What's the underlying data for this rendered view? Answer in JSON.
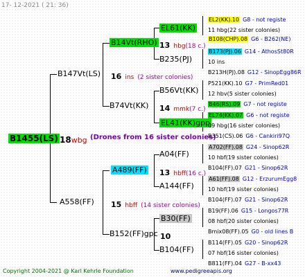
{
  "header": {
    "date": "17- 12-2021 ( 21: 36)"
  },
  "root": {
    "name": "B1455(LS)",
    "num": "18",
    "sub": "wbg",
    "note": "(Drones from 16 sister colonies)"
  },
  "l1": [
    {
      "name": "B147Vt(LS)",
      "num": "16",
      "sub": "ins",
      "note": "(2 sister colonies)"
    },
    {
      "name": "A558(FF)",
      "num": "15",
      "sub": "hbff",
      "note": "(14 sister colonies)"
    }
  ],
  "l2": [
    {
      "name": "B14Vt(RHO)",
      "num": "13",
      "sub": "hbg",
      "note": "(18 c.)"
    },
    {
      "name": "B74Vt(KK)",
      "num": "14",
      "sub": "mmk",
      "note": "(7 c.)"
    },
    {
      "name": "A489(FF)",
      "num": "13",
      "sub": "hbff",
      "note": "(16 c.)"
    },
    {
      "name": "B152(FF)gpc",
      "num": "10",
      "sub": "",
      "note": ""
    }
  ],
  "l3": [
    {
      "name": "EL61(KK)"
    },
    {
      "name": "B235(PJ)"
    },
    {
      "name": "B56Vt(KK)"
    },
    {
      "name": "EL41(KK)gpp"
    },
    {
      "name": "A04(FF)"
    },
    {
      "name": "A144(FF)"
    },
    {
      "name": "B30(FF)"
    },
    {
      "name": "B104(FF)"
    }
  ],
  "l4": [
    {
      "name": "EL2(KK).10",
      "info": "G8 - not registe"
    },
    {
      "name": "11 hbg(22 sister colonies)"
    },
    {
      "name": "B108(CHP).08",
      "info": "G6 - B262(NE)"
    },
    {
      "name": "B173(PJ).06",
      "info": "G14 - AthosSt80R"
    },
    {
      "name": "10 ins"
    },
    {
      "name": "B213H(PJ).08",
      "info": "G12 - SinopEgg86R"
    },
    {
      "name": "P521(KK).10",
      "info": "G7 - PrimRed01"
    },
    {
      "name": "12 hbv(5 sister colonies)"
    },
    {
      "name": "B46(RS).09",
      "info": "G7 - not registe"
    },
    {
      "name": "EL74(KK).07",
      "info": "G6 - not registe"
    },
    {
      "name": "09 hbg(16 sister colonies)"
    },
    {
      "name": "B351(CS).06",
      "info": "G6 - Cankiri97Q"
    },
    {
      "name": "A702(FF).08",
      "info": "G24 - Sinop62R"
    },
    {
      "name": "10 hbf(19 sister colonies)"
    },
    {
      "name": "B104(FF).07",
      "info": "G21 - Sinop62R"
    },
    {
      "name": "A61(FF).08",
      "info": "G12 - ErzurumEgg8"
    },
    {
      "name": "10 hbf(19 sister colonies)"
    },
    {
      "name": "B104(FF).07",
      "info": "G21 - Sinop62R"
    },
    {
      "name": "B19(FF).06",
      "info": "G15 - Longos77R"
    },
    {
      "name": "08 hbf(20 sister colonies)"
    },
    {
      "name": "Bmix08(FF).05",
      "info": "G0 - old lines B"
    },
    {
      "name": "B114(FF).05",
      "info": "G20 - Sinop62R"
    },
    {
      "name": "07 hbf(16 sister colonies)"
    },
    {
      "name": "B811(FF).04",
      "info": "G27 - B-xx43"
    }
  ],
  "footer": {
    "copyright": "Copyright 2004-2021 @ Karl Kehrle Foundation",
    "site": "www.pedigreeapis.org"
  }
}
